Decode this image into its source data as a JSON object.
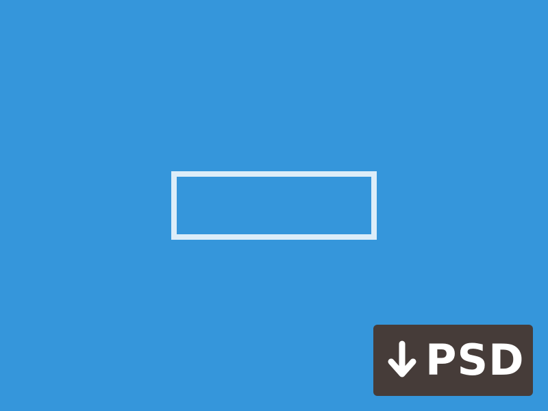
{
  "colors": {
    "background": "#3596DB",
    "button_border": "#DCEDF9",
    "badge_background": "#463C39",
    "badge_text": "#FFFFFF"
  },
  "outline_button": {
    "label": ""
  },
  "download_badge": {
    "icon": "arrow-down-icon",
    "label": "PSD"
  }
}
